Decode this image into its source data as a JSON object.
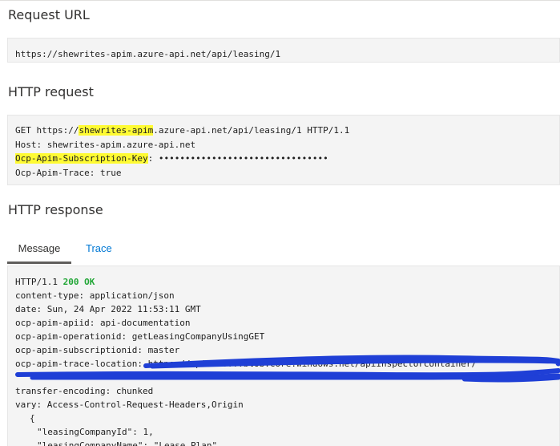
{
  "sections": {
    "request_url_title": "Request URL",
    "http_request_title": "HTTP request",
    "http_response_title": "HTTP response"
  },
  "request_url": "https://shewrites-apim.azure-api.net/api/leasing/1",
  "http_request": {
    "line1_prefix": "GET https://",
    "line1_host_highlight": "shewrites-apim",
    "line1_suffix": ".azure-api.net/api/leasing/1 HTTP/1.1",
    "host_line": "Host: shewrites-apim.azure-api.net",
    "subscription_key_name": "Ocp-Apim-Subscription-Key",
    "subscription_key_value": ": ••••••••••••••••••••••••••••••••",
    "trace_line": "Ocp-Apim-Trace: true"
  },
  "tabs": {
    "message": "Message",
    "trace": "Trace"
  },
  "http_response": {
    "status_prefix": "HTTP/1.1 ",
    "status_code": "200 OK",
    "headers": [
      "content-type: application/json",
      "date: Sun, 24 Apr 2022 11:53:11 GMT",
      "ocp-apim-apiid: api-documentation",
      "ocp-apim-operationid: getLeasingCompanyUsingGET",
      "ocp-apim-subscriptionid: master",
      "ocp-apim-trace-location: https://apimst0...blob.core.windows.net/apiinspectorcontainer/",
      "",
      "transfer-encoding: chunked",
      "vary: Access-Control-Request-Headers,Origin"
    ],
    "body_open": "{",
    "body_line1": "\"leasingCompanyId\": 1,",
    "body_line2": "\"leasingCompanyName\": \"Lease Plan\","
  },
  "colors": {
    "highlight": "#fffb33",
    "status_ok": "#21a636",
    "tab_link": "#0078d4",
    "redaction": "#1f3fd6"
  }
}
